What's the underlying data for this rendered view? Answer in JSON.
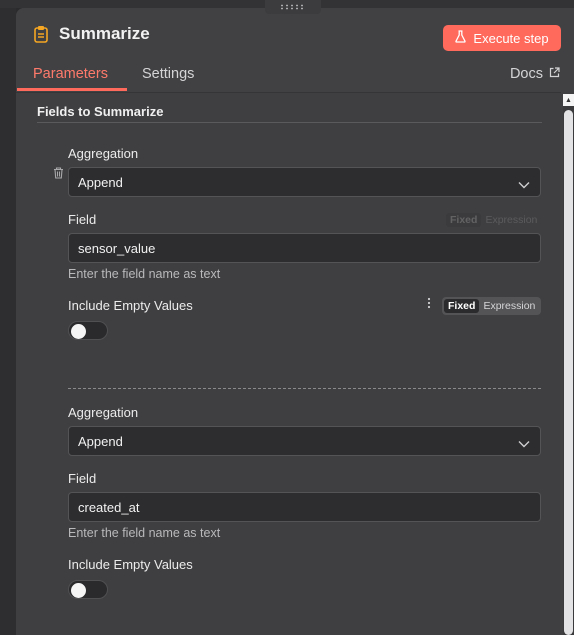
{
  "header": {
    "title": "Summarize",
    "execute_label": "Execute step"
  },
  "tabs": [
    {
      "label": "Parameters",
      "active": true
    },
    {
      "label": "Settings",
      "active": false
    }
  ],
  "docs_label": "Docs",
  "section_title": "Fields to Summarize",
  "groups": [
    {
      "aggregation_label": "Aggregation",
      "aggregation_value": "Append",
      "field_label": "Field",
      "field_value": "sensor_value",
      "field_hint": "Enter the field name as text",
      "include_empty_label": "Include Empty Values",
      "mode_fixed": "Fixed",
      "mode_expression": "Expression",
      "include_empty_on": false
    },
    {
      "aggregation_label": "Aggregation",
      "aggregation_value": "Append",
      "field_label": "Field",
      "field_value": "created_at",
      "field_hint": "Enter the field name as text",
      "include_empty_label": "Include Empty Values",
      "include_empty_on": false
    }
  ],
  "colors": {
    "accent": "#ff6a5c",
    "panel": "#404042",
    "input_bg": "#2d2d2f"
  },
  "icons": {
    "title": "clipboard-icon",
    "execute": "flask-icon",
    "docs": "external-link-icon",
    "delete": "trash-icon",
    "dropdown": "chevron-down-icon",
    "options": "kebab-menu-icon"
  }
}
